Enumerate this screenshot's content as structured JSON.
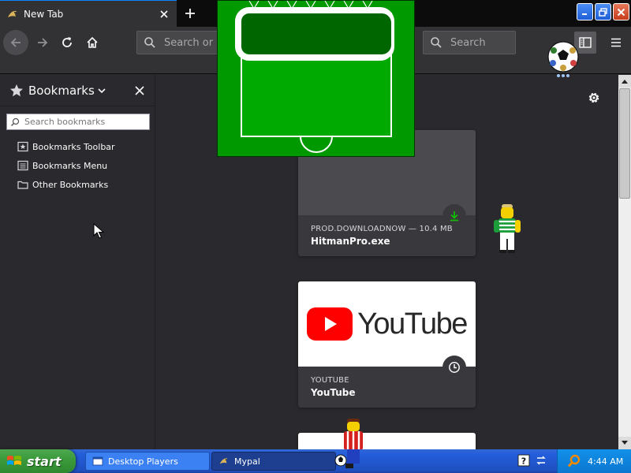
{
  "tabs": [
    {
      "label": "New Tab",
      "active": true
    }
  ],
  "navbar": {
    "url_placeholder": "Search or enter address",
    "search_placeholder": "Search"
  },
  "sidebar": {
    "title": "Bookmarks",
    "search_placeholder": "Search bookmarks",
    "items": [
      {
        "label": "Bookmarks Toolbar",
        "icon": "bookmarks-toolbar-icon"
      },
      {
        "label": "Bookmarks Menu",
        "icon": "bookmarks-menu-icon"
      },
      {
        "label": "Other Bookmarks",
        "icon": "folder-icon"
      }
    ]
  },
  "highlights": [
    {
      "source": "PROD.DOWNLOADNOW — 10.4 MB",
      "title": "HitmanPro.exe",
      "badge": "download-icon"
    },
    {
      "source": "YOUTUBE",
      "title": "YouTube",
      "badge": "clock-icon",
      "thumb_text": "YouTube"
    }
  ],
  "taskbar": {
    "start_label": "start",
    "tasks": [
      {
        "label": "Desktop Players"
      },
      {
        "label": "Mypal"
      }
    ],
    "clock": "4:44 AM"
  },
  "colors": {
    "accent": "#0a84ff",
    "pitch_green": "#009900",
    "youtube_red": "#ff0000",
    "download_green": "#12bc00",
    "xp_blue": "#245edb",
    "xp_start_green": "#3c9a3c"
  }
}
